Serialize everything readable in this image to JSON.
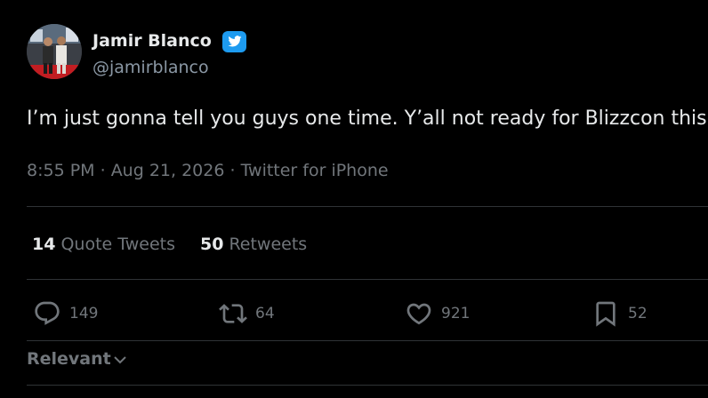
{
  "author": {
    "display_name": "Jamir Blanco",
    "handle": "@jamirblanco",
    "verified_icon": "twitter-verified-bird-icon"
  },
  "tweet": {
    "text": "I’m just gonna tell you guys one time. Y’all not ready for Blizzcon this year."
  },
  "meta": {
    "time": "8:55 PM",
    "separator": " · ",
    "date": "Aug 21, 2026",
    "source": "Twitter for iPhone"
  },
  "stats": {
    "quote_tweets_count": "14",
    "quote_tweets_label": "Quote Tweets",
    "retweets_count": "50",
    "retweets_label": "Retweets"
  },
  "actions": {
    "reply_count": "149",
    "retweet_count": "64",
    "like_count": "921",
    "bookmark_count": "52"
  },
  "sort": {
    "label": "Relevant"
  },
  "colors": {
    "background": "#000000",
    "text_primary": "#e7e9ea",
    "text_secondary": "#71767b",
    "divider": "#2f3336",
    "verified_blue": "#1d9bf0"
  }
}
